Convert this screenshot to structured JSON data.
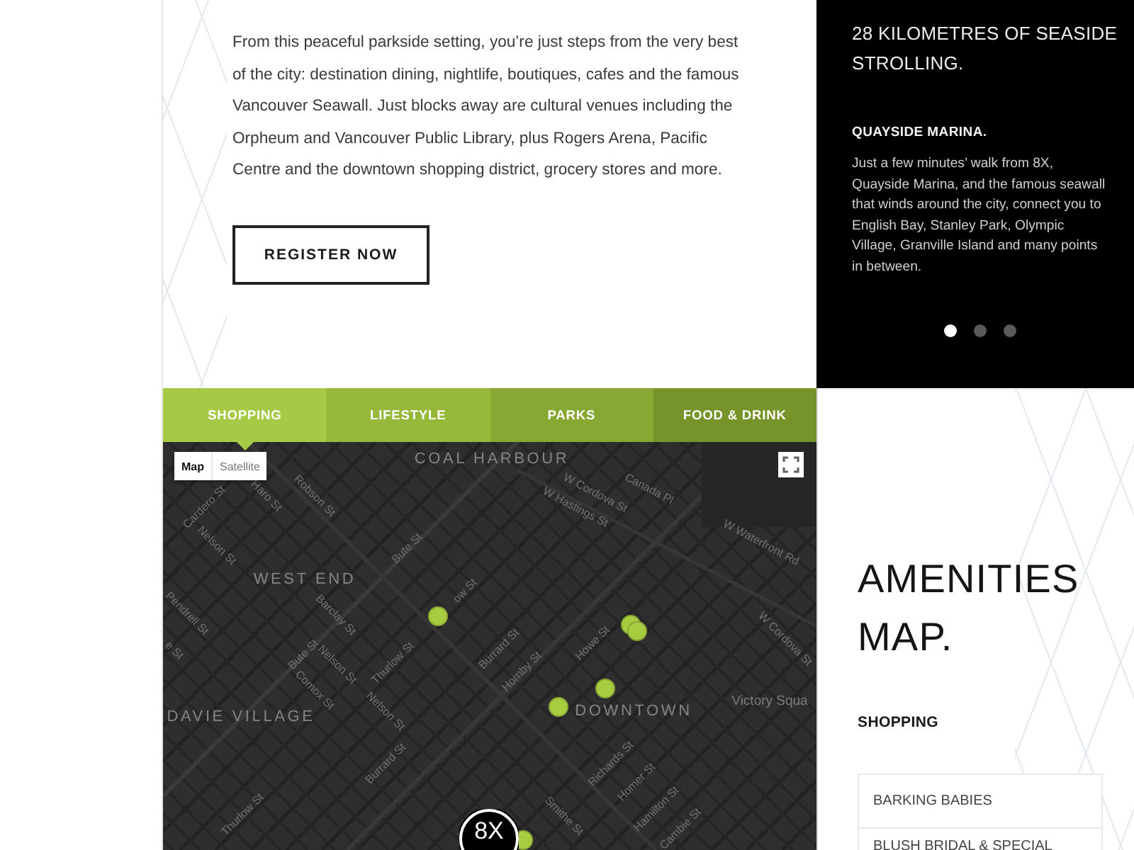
{
  "intro": {
    "paragraph": "From this peaceful parkside setting, you’re just steps from the very best of the city: destination dining, nightlife, boutiques, cafes and the famous Vancouver Seawall. Just blocks away are cultural venues including the Orpheum and Vancouver Public Library, plus Rogers Arena, Pacific Centre and the downtown shopping district, grocery stores and more.",
    "button": "REGISTER NOW"
  },
  "seaside": {
    "heading": "28 KILOMETRES OF SEASIDE STROLLING.",
    "subheading": "QUAYSIDE MARINA.",
    "paragraph": "Just a few minutes’ walk from 8X, Quayside Marina, and the famous seawall that winds around the city, connect you to English Bay, Stanley Park, Olympic Village, Granville Island and many points in between.",
    "dots": [
      {
        "selected": true
      },
      {
        "selected": false
      },
      {
        "selected": false
      }
    ]
  },
  "tabs": [
    {
      "label": "SHOPPING",
      "selected": true,
      "color": "#a6ca45"
    },
    {
      "label": "LIFESTYLE",
      "selected": false,
      "color": "#97b93b"
    },
    {
      "label": "PARKS",
      "selected": false,
      "color": "#87a832"
    },
    {
      "label": "FOOD & DRINK",
      "selected": false,
      "color": "#76942a"
    }
  ],
  "map": {
    "type_toggle": [
      {
        "label": "Map",
        "selected": true
      },
      {
        "label": "Satellite",
        "selected": false
      }
    ],
    "labels": [
      {
        "text": "COAL HARBOUR",
        "kind": "area"
      },
      {
        "text": "Canada Pl",
        "kind": "street"
      },
      {
        "text": "W Cordova St",
        "kind": "street"
      },
      {
        "text": "Haro St",
        "kind": "street"
      },
      {
        "text": "Robson St",
        "kind": "street"
      },
      {
        "text": "Cardero St",
        "kind": "street"
      },
      {
        "text": "W Hastings St",
        "kind": "street"
      },
      {
        "text": "W Waterfront Rd",
        "kind": "street"
      },
      {
        "text": "Nelson St",
        "kind": "street"
      },
      {
        "text": "Bute St",
        "kind": "street"
      },
      {
        "text": "WEST END",
        "kind": "area"
      },
      {
        "text": "Pendrell St",
        "kind": "street"
      },
      {
        "text": "Barclay St",
        "kind": "street"
      },
      {
        "text": "ow St",
        "kind": "street"
      },
      {
        "text": "W Cordova St",
        "kind": "street"
      },
      {
        "text": "Howe St",
        "kind": "street"
      },
      {
        "text": "Burrard St",
        "kind": "street"
      },
      {
        "text": "e St",
        "kind": "street"
      },
      {
        "text": "Bute St",
        "kind": "street"
      },
      {
        "text": "Nelson St",
        "kind": "street"
      },
      {
        "text": "Thurlow St",
        "kind": "street"
      },
      {
        "text": "Hornby St",
        "kind": "street"
      },
      {
        "text": "Comox St",
        "kind": "street"
      },
      {
        "text": "Victory Squa",
        "kind": "place"
      },
      {
        "text": "DOWNTOWN",
        "kind": "area"
      },
      {
        "text": "Nelson St",
        "kind": "street"
      },
      {
        "text": "DAVIE VILLAGE",
        "kind": "area"
      },
      {
        "text": "Burrard St",
        "kind": "street"
      },
      {
        "text": "Richards St",
        "kind": "street"
      },
      {
        "text": "Homer St",
        "kind": "street"
      },
      {
        "text": "Hamilton St",
        "kind": "street"
      },
      {
        "text": "Smithe St",
        "kind": "street"
      },
      {
        "text": "Thurlow St",
        "kind": "street"
      },
      {
        "text": "Cambie St",
        "kind": "street"
      }
    ],
    "logo": "8X"
  },
  "amenities": {
    "heading": "AMENITIES MAP.",
    "category": "SHOPPING",
    "items": [
      "BARKING BABIES",
      "BLUSH BRIDAL & SPECIAL"
    ]
  }
}
